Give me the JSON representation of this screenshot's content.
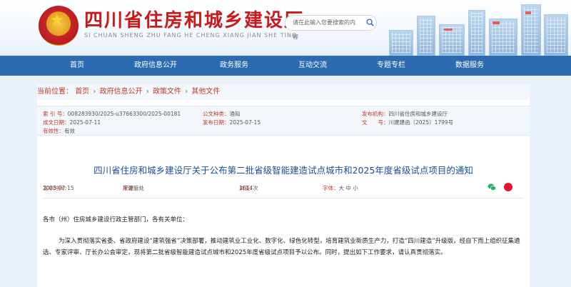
{
  "header": {
    "site_title": "四川省住房和城乡建设厅",
    "site_pinyin": "SI CHUAN SHENG ZHU FANG HE CHENG XIANG JIAN SHE TING",
    "search_placeholder": "请在此输入您要搜索的内容",
    "brand_color": "#c81a1a"
  },
  "nav": {
    "items": [
      "首页",
      "政府信息公开",
      "政务服务",
      "互动交流",
      "专题专栏",
      "数据服务"
    ],
    "bg_color": "#2c6ab1"
  },
  "breadcrumb": {
    "prefix": "当前位置：",
    "items": [
      "首页",
      "政府信息公开",
      "政策文件",
      "其他文件"
    ],
    "sep": "›"
  },
  "meta": {
    "index_label": "索 引 号：",
    "index_value": "008283930/2025-u37663300/2025-00181",
    "category_label": "公文种类：",
    "category_value": "通知",
    "issuer_label": "发布机构：",
    "issuer_value": "四川省住房和城乡建设厅",
    "created_label": "成文日期：",
    "created_value": "2025-07-11",
    "published_label": "发布日期：",
    "published_value": "2025-07-15",
    "docno_label": "文　　号：",
    "docno_value": "川建建函〔2025〕1799号",
    "validity_label": "有效性：",
    "validity_value": "有效"
  },
  "article": {
    "title": "四川省住房和城乡建设厅关于公布第二批省级智能建造试点城市和2025年度省级试点项目的通知",
    "date_label": "发布时间：",
    "date_value": "2025-07-15",
    "source_label": "来源：",
    "source_value": "厅建管处",
    "views_label": "浏览：",
    "views_value": "1614次",
    "font_label": "字体：",
    "font_large": "大",
    "font_medium": "中",
    "font_small": "小",
    "greeting": "各市（州）住房城乡建设行政主管部门，各有关单位：",
    "paragraph": "为深入贯彻落实省委、省政府建设“建筑强省”决策部署，推动建筑业工业化、数字化、绿色化转型，培育建筑业新质生产力，打造“四川建造”升级版，经自下而上组织征集遴选、专家评审、厅长办公会审定，现将第二批省级智能建造试点城市和2025年度省级试点项目予以公布。同时，提出如下工作要求，请认真贯彻落实。"
  },
  "icons": {
    "search": "search-icon",
    "wechat": "wechat-icon",
    "weibo": "weibo-icon",
    "emblem": "national-emblem-icon"
  }
}
